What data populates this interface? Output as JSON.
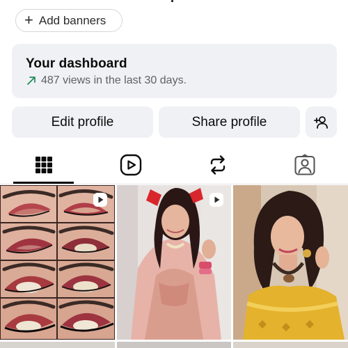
{
  "banner": {
    "label": "Add banners",
    "icon": "plus-icon"
  },
  "dashboard": {
    "title": "Your dashboard",
    "subtitle": "487 views in the last 30 days.",
    "icon": "trending-up-arrow-icon",
    "accent": "#1f8a57"
  },
  "actions": {
    "edit_label": "Edit profile",
    "share_label": "Share profile",
    "add_person_icon": "add-person-icon"
  },
  "tabs": [
    {
      "name": "grid",
      "icon": "grid-icon",
      "active": true
    },
    {
      "name": "reels",
      "icon": "reels-icon",
      "active": false
    },
    {
      "name": "reposts",
      "icon": "repost-icon",
      "active": false
    },
    {
      "name": "tagged",
      "icon": "tagged-person-icon",
      "active": false
    }
  ],
  "posts": [
    {
      "kind": "reel",
      "subject": "eye makeup tutorial collage"
    },
    {
      "kind": "reel",
      "subject": "girl in pink lehenga with red hair bow"
    },
    {
      "kind": "post",
      "subject": "girl in yellow outfit with jewelry"
    }
  ],
  "colors": {
    "surface": "#eff1f4",
    "text": "#0c0c0c",
    "muted": "#5e6166"
  }
}
